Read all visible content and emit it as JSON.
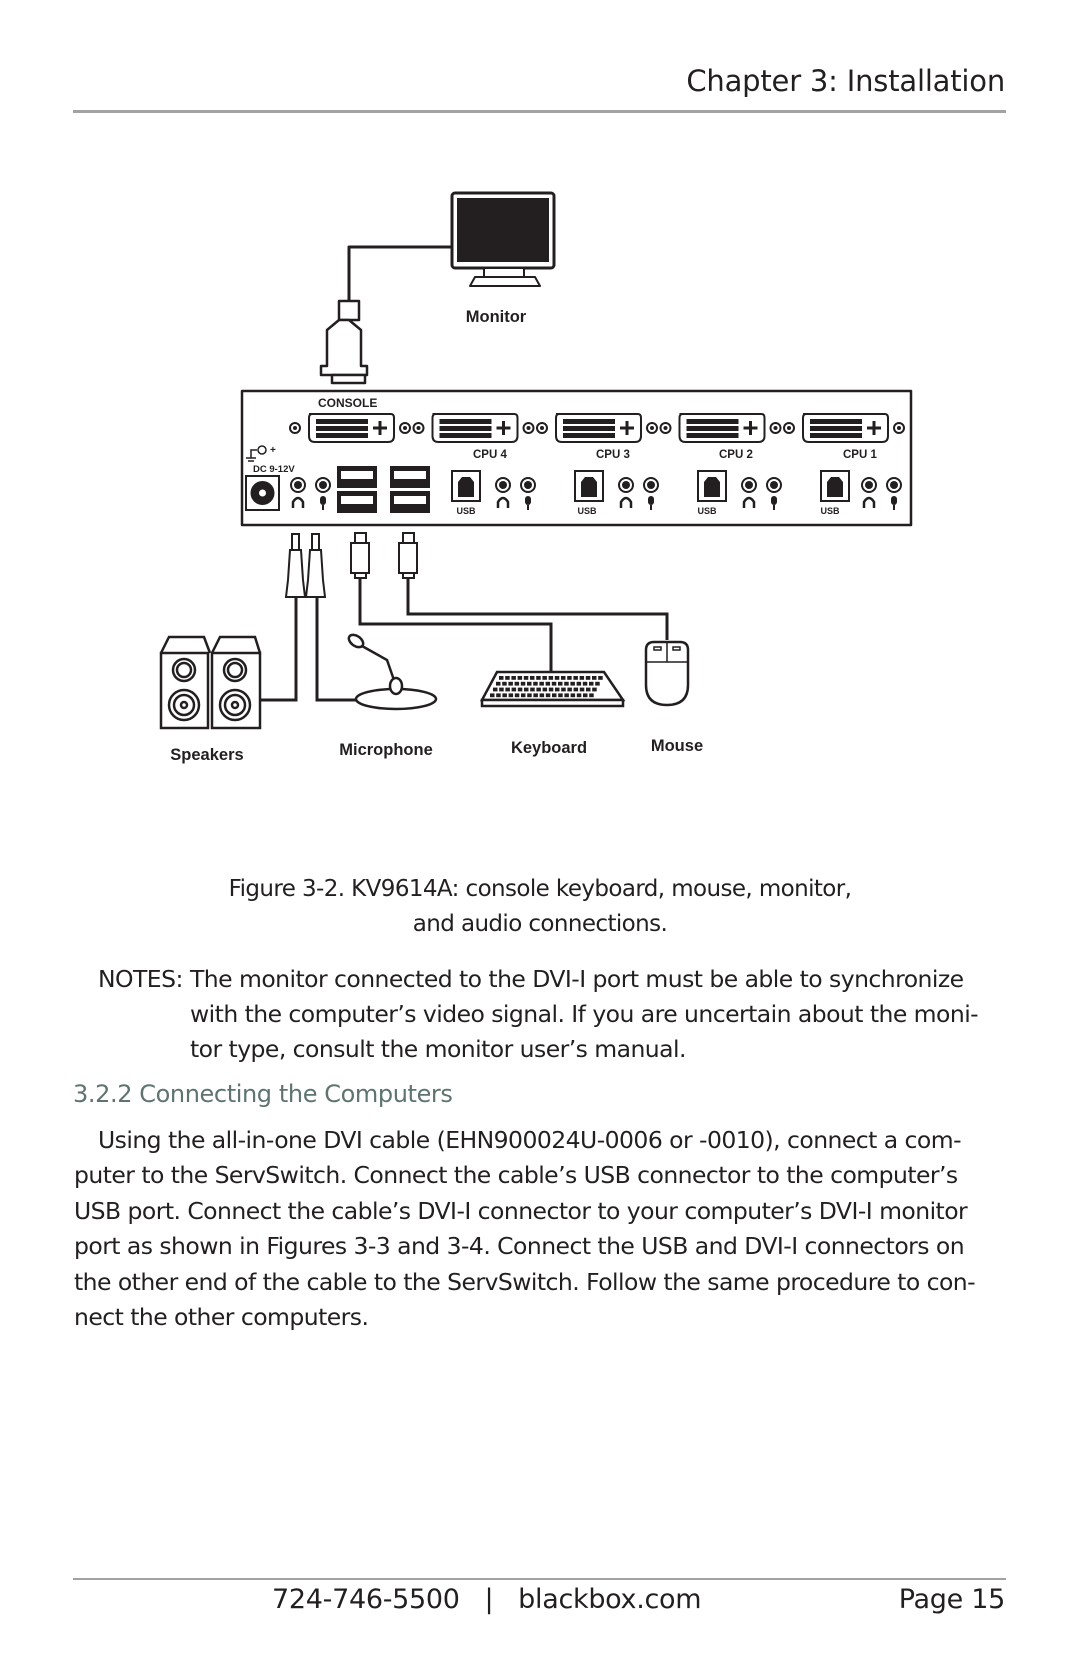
{
  "header": {
    "chapter_title": "Chapter 3: Installation"
  },
  "figure": {
    "labels": {
      "monitor": "Monitor",
      "console": "CONSOLE",
      "power": "DC 9-12V",
      "power_polarity": "+",
      "cpu_ports": [
        "CPU 4",
        "CPU 3",
        "CPU 2",
        "CPU 1"
      ],
      "usb": "USB",
      "speakers": "Speakers",
      "microphone": "Microphone",
      "keyboard": "Keyboard",
      "mouse": "Mouse"
    },
    "caption_line1": "Figure 3-2. KV9614A: console keyboard, mouse, monitor,",
    "caption_line2": "and audio connections."
  },
  "notes": {
    "label": "NOTES:",
    "lines": [
      "The monitor connected to the DVI-I port must be able to synchronize",
      "with the computer’s video signal. If you are uncertain about the moni-",
      "tor type, consult the monitor user’s manual."
    ]
  },
  "section": {
    "heading": "3.2.2 Connecting the Computers",
    "color": "#5f7471",
    "body_lines": [
      "Using the all-in-one DVI cable (EHN900024U-0006 or -0010), connect a com-",
      "puter to the ServSwitch. Connect the cable’s USB connector to the computer’s",
      "USB port. Connect the cable’s DVI-I connector to your computer’s DVI-I monitor",
      "port as shown in Figures 3-3 and 3-4. Connect the USB and DVI-I connectors on",
      "the other end of the cable to the ServSwitch. Follow the same procedure to con-",
      "nect the other computers."
    ]
  },
  "footer": {
    "contact": "724-746-5500   |   blackbox.com",
    "page": "Page 15"
  }
}
